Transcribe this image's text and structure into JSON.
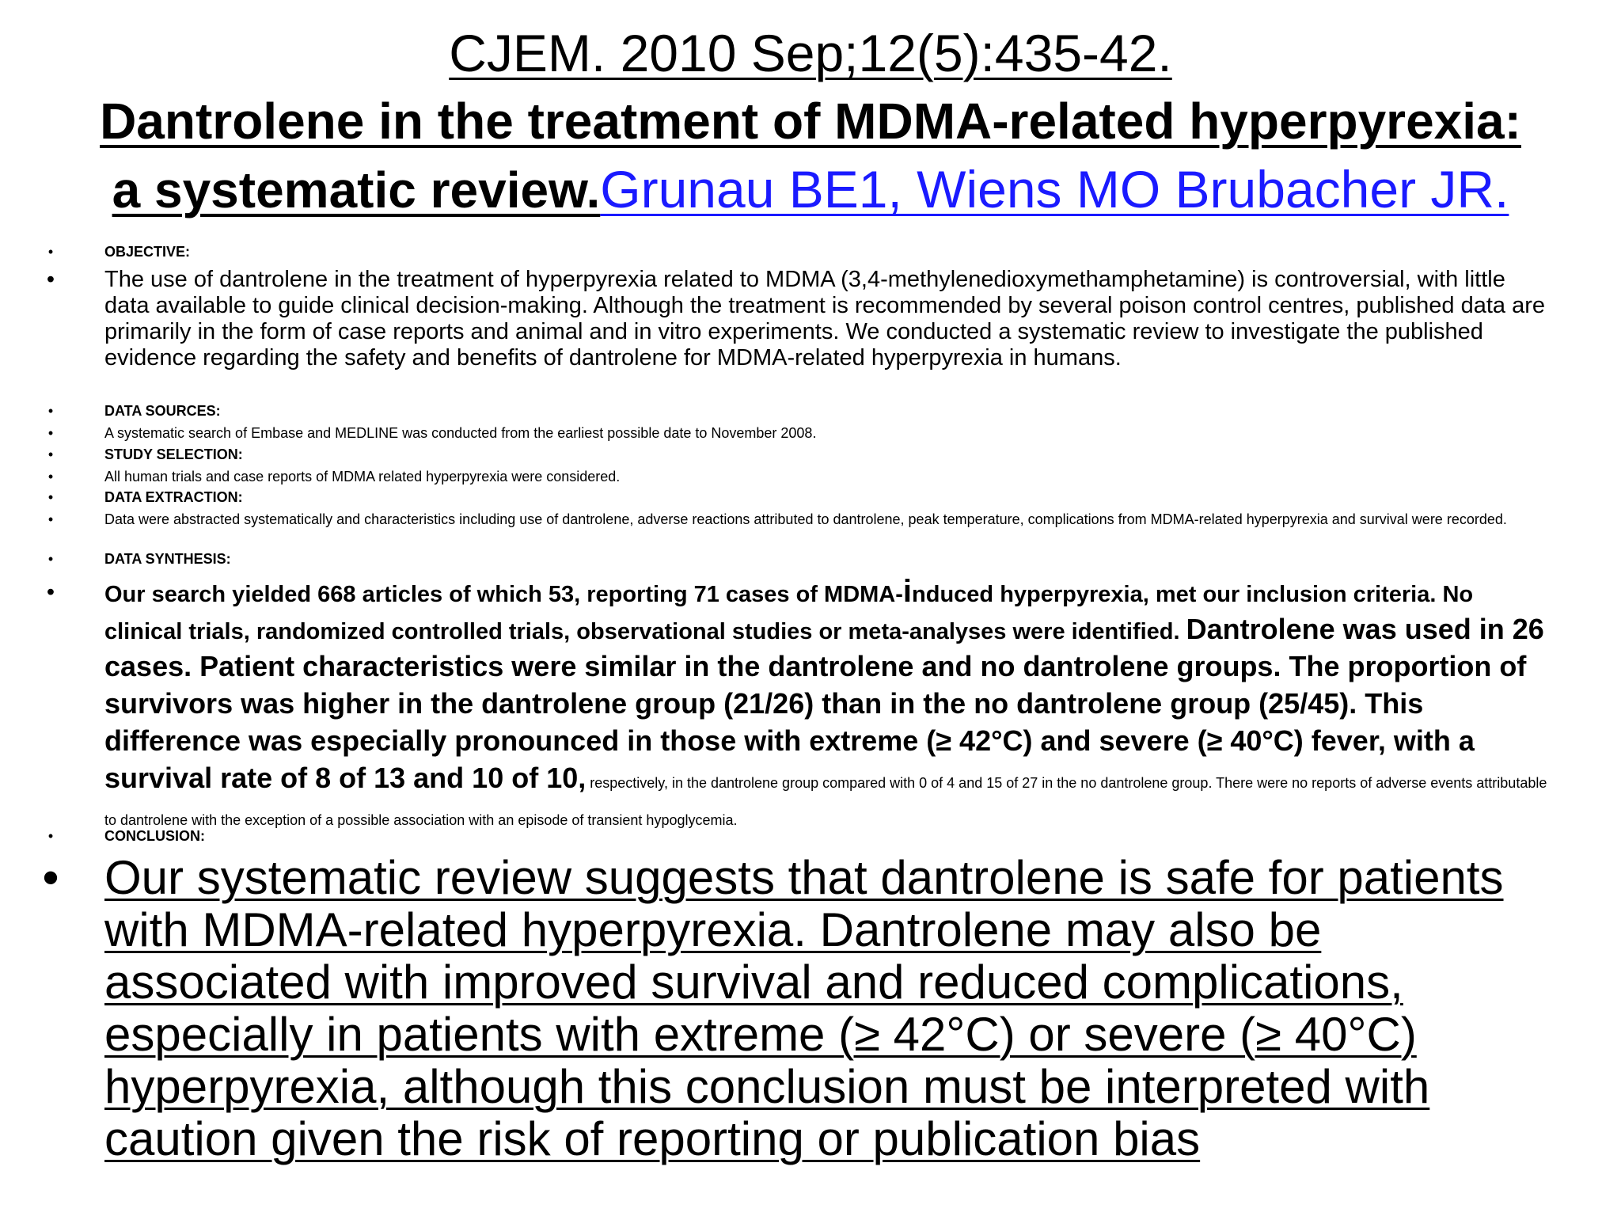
{
  "header": {
    "citation": "CJEM. 2010 Sep;12(5):435-42.",
    "title_line1": "Dantrolene in the treatment of MDMA-related hyperpyrexia:",
    "title_line2": "a systematic review.",
    "authors": "Grunau BE1, Wiens MO Brubacher JR."
  },
  "bullet_glyph": "•",
  "abstract": {
    "objective_heading": "OBJECTIVE:",
    "objective_text": "The use of dantrolene in the treatment of hyperpyrexia related to MDMA (3,4-methylenedioxymethamphetamine) is controversial, with little data available to guide clinical decision-making. Although the treatment is recommended by several poison control centres, published data are primarily in the form of case reports and animal and in vitro experiments. We conducted a systematic review to investigate the published evidence regarding the safety and benefits of dantrolene for MDMA-related hyperpyrexia in humans.",
    "data_sources_heading": "DATA SOURCES:",
    "data_sources_text": "A systematic search of Embase and MEDLINE was conducted from the earliest possible date to November 2008.",
    "study_selection_heading": "STUDY SELECTION:",
    "study_selection_text": "All human trials and case reports of MDMA related hyperpyrexia were considered.",
    "data_extraction_heading": "DATA EXTRACTION:",
    "data_extraction_text": "Data were abstracted systematically and characteristics including use of dantrolene, adverse reactions attributed to dantrolene, peak temperature, complications from MDMA-related hyperpyrexia and survival were recorded.",
    "data_synthesis_heading": "DATA SYNTHESIS:",
    "synthesis_part1a": "Our search yielded 668 articles of which 53, reporting 71 cases of MDMA-",
    "synthesis_part1_i": "i",
    "synthesis_part1b": "nduced hyperpyrexia, met our inclusion criteria. No clinical trials, randomized controlled trials, observational studies or meta-analyses were identified. ",
    "synthesis_part2": "Dantrolene was used in 26 cases. Patient characteristics were similar in the dantrolene and no dantrolene groups. The proportion of survivors was higher in the dantrolene group (21/26) than in the no dantrolene group (25/45). This difference was especially pronounced in those with extreme (≥ 42°C) and severe (≥ 40°C) fever, with a survival rate of 8 of 13 and 10 of 10,",
    "synthesis_part3": " respectively, in the dantrolene group compared with 0 of 4 and 15 of 27 in the no dantrolene group. There were no reports of adverse events attributable to dantrolene with the exception of a possible association with an episode of transient hypoglycemia.",
    "conclusion_heading": "CONCLUSION:",
    "conclusion_text": "Our systematic review suggests that dantrolene is safe for patients with MDMA-related hyperpyrexia. Dantrolene may also be associated with improved survival and reduced complications, especially in patients with extreme (≥ 42°C) or severe (≥ 40°C) hyperpyrexia, although this conclusion must be interpreted with caution given the risk of reporting or publication bias"
  }
}
